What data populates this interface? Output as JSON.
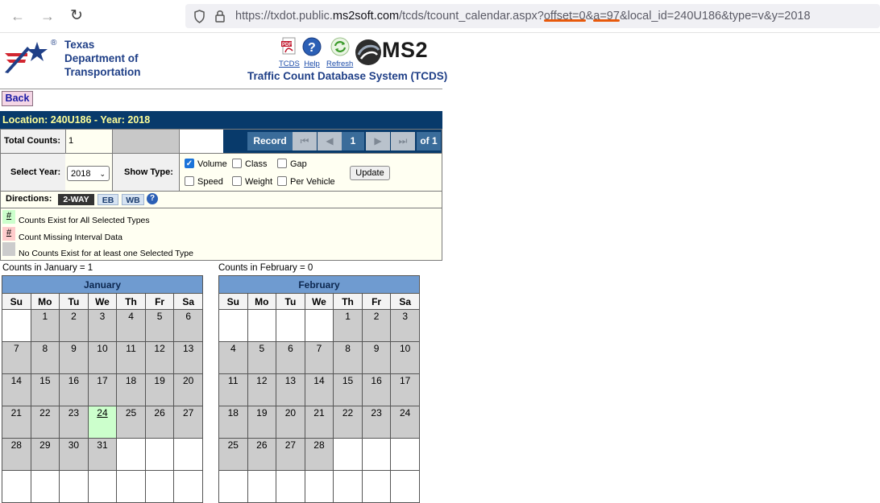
{
  "browser": {
    "url_prefix": "https://txdot.public.",
    "url_domain": "ms2soft.com",
    "url_path": "/tcds/tcount_calendar.aspx?",
    "url_hl1": "offset=0",
    "url_amp": "&",
    "url_hl2": "a=97",
    "url_rest": "&local_id=240U186&type=v&y=2018"
  },
  "header": {
    "org_line1": "Texas",
    "org_line2": "Department of",
    "org_line3": "Transportation",
    "reg_mark": "®",
    "tools": [
      {
        "label": "TCDS",
        "icon": "pdf-icon"
      },
      {
        "label": "Help",
        "icon": "help-icon"
      },
      {
        "label": "Refresh",
        "icon": "refresh-icon"
      }
    ],
    "ms2_label": "MS2",
    "system_title": "Traffic Count Database System (TCDS)"
  },
  "back_label": "Back",
  "location_title": "Location: 240U186 - Year: 2018",
  "totals": {
    "label": "Total Counts:",
    "value": "1"
  },
  "record": {
    "label": "Record",
    "current": "1",
    "of": "of 1"
  },
  "filters": {
    "year_label": "Select Year:",
    "year_value": "2018",
    "type_label": "Show Type:",
    "types": [
      {
        "label": "Volume",
        "checked": true
      },
      {
        "label": "Class",
        "checked": false
      },
      {
        "label": "Gap",
        "checked": false
      },
      {
        "label": "Speed",
        "checked": false
      },
      {
        "label": "Weight",
        "checked": false
      },
      {
        "label": "Per Vehicle",
        "checked": false
      }
    ],
    "update_label": "Update"
  },
  "directions": {
    "label": "Directions:",
    "options": [
      {
        "label": "2-WAY",
        "active": true
      },
      {
        "label": "EB",
        "active": false
      },
      {
        "label": "WB",
        "active": false
      }
    ]
  },
  "legend": [
    {
      "symbol": "#",
      "text": "Counts Exist for All Selected Types",
      "color": "#ccffcc"
    },
    {
      "symbol": "#",
      "text": "Count Missing Interval Data",
      "color": "#ffcccc"
    },
    {
      "symbol": "",
      "text": "No Counts Exist for at least one Selected Type",
      "color": "#cccccc"
    }
  ],
  "calendars": [
    {
      "count_text": "Counts in January = 1",
      "month": "January",
      "weekdays": [
        "Su",
        "Mo",
        "Tu",
        "We",
        "Th",
        "Fr",
        "Sa"
      ],
      "weeks": [
        [
          "",
          "1",
          "2",
          "3",
          "4",
          "5",
          "6"
        ],
        [
          "7",
          "8",
          "9",
          "10",
          "11",
          "12",
          "13"
        ],
        [
          "14",
          "15",
          "16",
          "17",
          "18",
          "19",
          "20"
        ],
        [
          "21",
          "22",
          "23",
          "24",
          "25",
          "26",
          "27"
        ],
        [
          "28",
          "29",
          "30",
          "31",
          "",
          "",
          ""
        ],
        [
          "",
          "",
          "",
          "",
          "",
          "",
          ""
        ]
      ],
      "count_days": [
        "24"
      ]
    },
    {
      "count_text": "Counts in February = 0",
      "month": "February",
      "weekdays": [
        "Su",
        "Mo",
        "Tu",
        "We",
        "Th",
        "Fr",
        "Sa"
      ],
      "weeks": [
        [
          "",
          "",
          "",
          "",
          "1",
          "2",
          "3"
        ],
        [
          "4",
          "5",
          "6",
          "7",
          "8",
          "9",
          "10"
        ],
        [
          "11",
          "12",
          "13",
          "14",
          "15",
          "16",
          "17"
        ],
        [
          "18",
          "19",
          "20",
          "21",
          "22",
          "23",
          "24"
        ],
        [
          "25",
          "26",
          "27",
          "28",
          "",
          "",
          ""
        ],
        [
          "",
          "",
          "",
          "",
          "",
          "",
          ""
        ]
      ],
      "count_days": []
    }
  ],
  "colors": {
    "accent_navy": "#083a6b",
    "location_text": "#ffff99",
    "count_exists": "#ccffcc",
    "missing_interval": "#ffcccc",
    "no_counts": "#cccccc",
    "month_header": "#6f9bd0"
  }
}
